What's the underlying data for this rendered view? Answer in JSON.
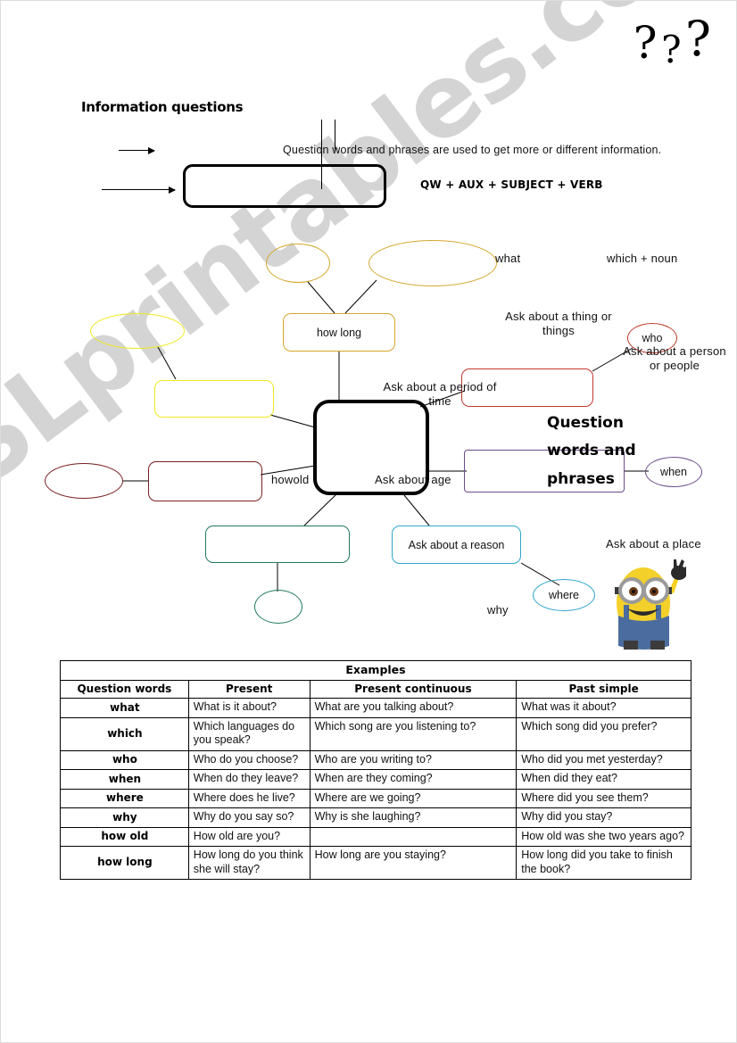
{
  "page": {
    "title": "Information questions",
    "question_marks": [
      "?",
      "?",
      "?"
    ],
    "watermark": "ESLprintables.com"
  },
  "intro": {
    "sentence": "Question words and phrases are used to get more or different information.",
    "formula": "QW + AUX + SUBJECT + VERB"
  },
  "diagram": {
    "center_label": "Question words and phrases",
    "nodes": {
      "how_long": "how long",
      "what": "what",
      "which_noun": "which + noun",
      "who": "who",
      "when": "when",
      "where": "where",
      "why": "why",
      "how_old": "howold"
    },
    "descriptions": {
      "period_of_time": "Ask about a period of time",
      "thing_or_things": "Ask about a thing or things",
      "person_or_people": "Ask about a person or people",
      "age": "Ask about age",
      "reason": "Ask about a reason",
      "place": "Ask about a place"
    }
  },
  "table": {
    "caption": "Examples",
    "headers": [
      "Question words",
      "Present",
      "Present continuous",
      "Past simple"
    ],
    "rows": [
      {
        "word": "what",
        "present": "What is it about?",
        "present_continuous": "What are you talking about?",
        "past_simple": "What was it about?"
      },
      {
        "word": "which",
        "present": "Which languages do you speak?",
        "present_continuous": "Which song are you listening to?",
        "past_simple": "Which song did you prefer?"
      },
      {
        "word": "who",
        "present": "Who do you choose?",
        "present_continuous": "Who are you writing to?",
        "past_simple": "Who did you met yesterday?"
      },
      {
        "word": "when",
        "present": "When do they leave?",
        "present_continuous": "When are they coming?",
        "past_simple": "When did they eat?"
      },
      {
        "word": "where",
        "present": "Where does he live?",
        "present_continuous": "Where are we going?",
        "past_simple": "Where did you see them?"
      },
      {
        "word": "why",
        "present": "Why do you say so?",
        "present_continuous": "Why is she laughing?",
        "past_simple": "Why did you stay?"
      },
      {
        "word": "how old",
        "present": "How old are you?",
        "present_continuous": "",
        "past_simple": "How old was she two years ago?"
      },
      {
        "word": "how long",
        "present": "How long do you think she will stay?",
        "present_continuous": "How long are you staying?",
        "past_simple": "How long did you take to finish the book?"
      }
    ]
  },
  "colors": {
    "gold": "#d4a72c",
    "yellow": "#f0e81e",
    "maroon": "#7a1f22",
    "red": "#c0392b",
    "purple": "#6c4c8c",
    "teal": "#1f7a5e",
    "cyan": "#2fa5cc",
    "black": "#000000",
    "watermark": "#cdcdcd"
  }
}
